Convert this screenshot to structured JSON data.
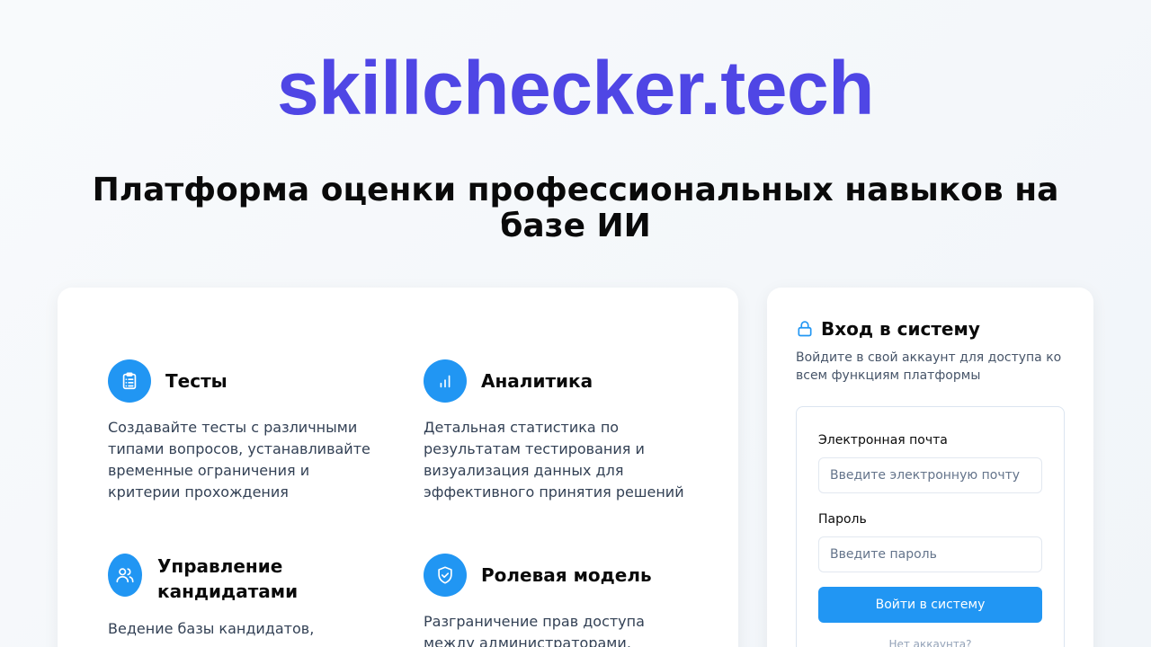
{
  "brand": {
    "name": "skillchecker.tech",
    "color": "#4f46e5"
  },
  "hero": {
    "headline": "Платформа оценки профессиональных навыков на базе ИИ"
  },
  "features": [
    {
      "icon": "clipboard-list-icon",
      "title": "Тесты",
      "description": "Создавайте тесты с различными типами вопросов, устанавливайте временные ограничения и критерии прохождения"
    },
    {
      "icon": "bar-chart-icon",
      "title": "Аналитика",
      "description": "Детальная статистика по результатам тестирования и визуализация данных для эффективного принятия решений"
    },
    {
      "icon": "users-icon",
      "title": "Управление кандидатами",
      "description": "Ведение базы кандидатов,"
    },
    {
      "icon": "shield-check-icon",
      "title": "Ролевая модель",
      "description": "Разграничение прав доступа между администраторами,"
    }
  ],
  "login": {
    "icon": "lock-icon",
    "title": "Вход в систему",
    "subtitle": "Войдите в свой аккаунт для доступа ко всем функциям платформы",
    "email_label": "Электронная почта",
    "email_placeholder": "Введите электронную почту",
    "email_value": "",
    "password_label": "Пароль",
    "password_placeholder": "Введите пароль",
    "password_value": "",
    "submit_label": "Войти в систему",
    "no_account_text": "Нет аккаунта?"
  },
  "colors": {
    "accent": "#2196f3",
    "brand": "#4f46e5",
    "background": "#f8fafc",
    "card": "#ffffff"
  }
}
